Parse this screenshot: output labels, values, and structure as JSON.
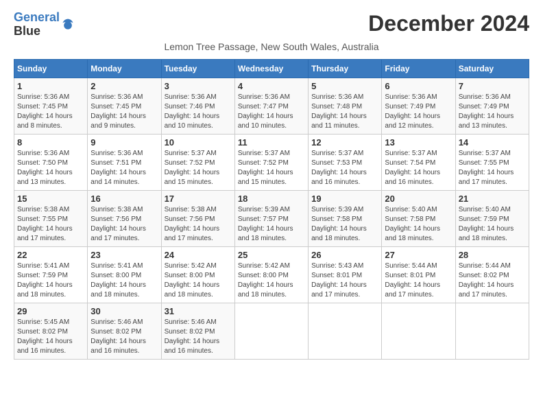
{
  "logo": {
    "line1": "General",
    "line2": "Blue"
  },
  "header": {
    "title": "December 2024",
    "subtitle": "Lemon Tree Passage, New South Wales, Australia"
  },
  "weekdays": [
    "Sunday",
    "Monday",
    "Tuesday",
    "Wednesday",
    "Thursday",
    "Friday",
    "Saturday"
  ],
  "weeks": [
    [
      {
        "day": "1",
        "sunrise": "5:36 AM",
        "sunset": "7:45 PM",
        "daylight": "14 hours and 8 minutes."
      },
      {
        "day": "2",
        "sunrise": "5:36 AM",
        "sunset": "7:45 PM",
        "daylight": "14 hours and 9 minutes."
      },
      {
        "day": "3",
        "sunrise": "5:36 AM",
        "sunset": "7:46 PM",
        "daylight": "14 hours and 10 minutes."
      },
      {
        "day": "4",
        "sunrise": "5:36 AM",
        "sunset": "7:47 PM",
        "daylight": "14 hours and 10 minutes."
      },
      {
        "day": "5",
        "sunrise": "5:36 AM",
        "sunset": "7:48 PM",
        "daylight": "14 hours and 11 minutes."
      },
      {
        "day": "6",
        "sunrise": "5:36 AM",
        "sunset": "7:49 PM",
        "daylight": "14 hours and 12 minutes."
      },
      {
        "day": "7",
        "sunrise": "5:36 AM",
        "sunset": "7:49 PM",
        "daylight": "14 hours and 13 minutes."
      }
    ],
    [
      {
        "day": "8",
        "sunrise": "5:36 AM",
        "sunset": "7:50 PM",
        "daylight": "14 hours and 13 minutes."
      },
      {
        "day": "9",
        "sunrise": "5:36 AM",
        "sunset": "7:51 PM",
        "daylight": "14 hours and 14 minutes."
      },
      {
        "day": "10",
        "sunrise": "5:37 AM",
        "sunset": "7:52 PM",
        "daylight": "14 hours and 15 minutes."
      },
      {
        "day": "11",
        "sunrise": "5:37 AM",
        "sunset": "7:52 PM",
        "daylight": "14 hours and 15 minutes."
      },
      {
        "day": "12",
        "sunrise": "5:37 AM",
        "sunset": "7:53 PM",
        "daylight": "14 hours and 16 minutes."
      },
      {
        "day": "13",
        "sunrise": "5:37 AM",
        "sunset": "7:54 PM",
        "daylight": "14 hours and 16 minutes."
      },
      {
        "day": "14",
        "sunrise": "5:37 AM",
        "sunset": "7:55 PM",
        "daylight": "14 hours and 17 minutes."
      }
    ],
    [
      {
        "day": "15",
        "sunrise": "5:38 AM",
        "sunset": "7:55 PM",
        "daylight": "14 hours and 17 minutes."
      },
      {
        "day": "16",
        "sunrise": "5:38 AM",
        "sunset": "7:56 PM",
        "daylight": "14 hours and 17 minutes."
      },
      {
        "day": "17",
        "sunrise": "5:38 AM",
        "sunset": "7:56 PM",
        "daylight": "14 hours and 17 minutes."
      },
      {
        "day": "18",
        "sunrise": "5:39 AM",
        "sunset": "7:57 PM",
        "daylight": "14 hours and 18 minutes."
      },
      {
        "day": "19",
        "sunrise": "5:39 AM",
        "sunset": "7:58 PM",
        "daylight": "14 hours and 18 minutes."
      },
      {
        "day": "20",
        "sunrise": "5:40 AM",
        "sunset": "7:58 PM",
        "daylight": "14 hours and 18 minutes."
      },
      {
        "day": "21",
        "sunrise": "5:40 AM",
        "sunset": "7:59 PM",
        "daylight": "14 hours and 18 minutes."
      }
    ],
    [
      {
        "day": "22",
        "sunrise": "5:41 AM",
        "sunset": "7:59 PM",
        "daylight": "14 hours and 18 minutes."
      },
      {
        "day": "23",
        "sunrise": "5:41 AM",
        "sunset": "8:00 PM",
        "daylight": "14 hours and 18 minutes."
      },
      {
        "day": "24",
        "sunrise": "5:42 AM",
        "sunset": "8:00 PM",
        "daylight": "14 hours and 18 minutes."
      },
      {
        "day": "25",
        "sunrise": "5:42 AM",
        "sunset": "8:00 PM",
        "daylight": "14 hours and 18 minutes."
      },
      {
        "day": "26",
        "sunrise": "5:43 AM",
        "sunset": "8:01 PM",
        "daylight": "14 hours and 17 minutes."
      },
      {
        "day": "27",
        "sunrise": "5:44 AM",
        "sunset": "8:01 PM",
        "daylight": "14 hours and 17 minutes."
      },
      {
        "day": "28",
        "sunrise": "5:44 AM",
        "sunset": "8:02 PM",
        "daylight": "14 hours and 17 minutes."
      }
    ],
    [
      {
        "day": "29",
        "sunrise": "5:45 AM",
        "sunset": "8:02 PM",
        "daylight": "14 hours and 16 minutes."
      },
      {
        "day": "30",
        "sunrise": "5:46 AM",
        "sunset": "8:02 PM",
        "daylight": "14 hours and 16 minutes."
      },
      {
        "day": "31",
        "sunrise": "5:46 AM",
        "sunset": "8:02 PM",
        "daylight": "14 hours and 16 minutes."
      },
      null,
      null,
      null,
      null
    ]
  ],
  "labels": {
    "sunrise": "Sunrise:",
    "sunset": "Sunset:",
    "daylight": "Daylight:"
  }
}
